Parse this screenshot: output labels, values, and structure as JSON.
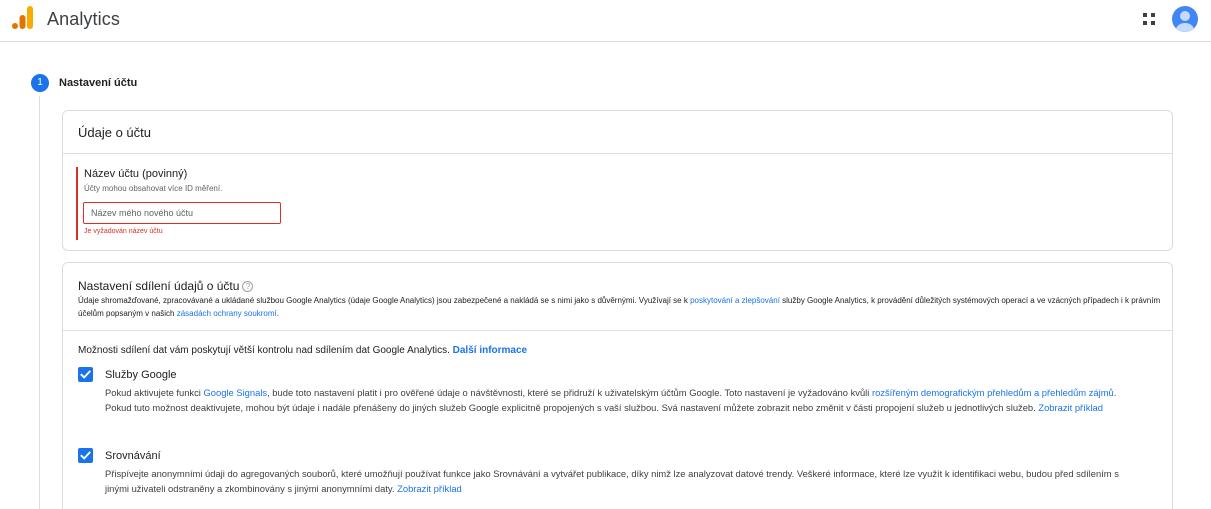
{
  "header": {
    "app_title": "Analytics",
    "icons": {
      "logo": "analytics-logo-icon",
      "apps": "apps-grid-icon",
      "avatar": "account-avatar"
    }
  },
  "stepper": {
    "step_number": "1",
    "step_title": "Nastavení účtu"
  },
  "account_card": {
    "title": "Údaje o účtu",
    "field": {
      "label": "Název účtu (povinný)",
      "hint": "Účty mohou obsahovat více ID měření.",
      "value": "",
      "placeholder": "Název mého nového účtu",
      "error": "Je vyžadován název účtu"
    }
  },
  "sharing_card": {
    "title": "Nastavení sdílení údajů o účtu",
    "help_icon": "?",
    "desc_1": "Údaje shromažďované, zpracovávané a ukládané službou Google Analytics (údaje Google Analytics) jsou zabezpečené a nakládá se s nimi jako s důvěrnými. Využívají se k ",
    "desc_link_1": "poskytování a zlepšování",
    "desc_2": " služby Google Analytics, k provádění důležitých systémových operací a ve vzácných případech i k právním účelům popsaným v našich ",
    "desc_link_2": "zásadách ochrany soukromí",
    "desc_3": ".",
    "options_intro": "Možnosti sdílení dat vám poskytují větší kontrolu nad sdílením dat Google Analytics. ",
    "options_intro_link": "Další informace",
    "options": [
      {
        "title": "Služby Google",
        "checked": true,
        "text_1": "Pokud aktivujete funkci ",
        "link_1": "Google Signals",
        "text_2": ", bude toto nastavení platit i pro ověřené údaje o návštěvnosti, které se přidruží k uživatelským účtům Google. Toto nastavení je vyžadováno kvůli ",
        "link_2": "rozšířeným demografickým přehledům a přehledům zájmů",
        "text_3": ". Pokud tuto možnost deaktivujete, mohou být údaje i nadále přenášeny do jiných služeb Google explicitně propojených s vaší službou. Svá nastavení můžete zobrazit nebo změnit v části propojení služeb u jednotlivých služeb. ",
        "link_3": "Zobrazit příklad"
      },
      {
        "title": "Srovnávání",
        "checked": true,
        "text_1": "Přispívejte anonymními údaji do agregovaných souborů, které umožňují používat funkce jako Srovnávání a vytvářet publikace, díky nimž lze analyzovat datové trendy. Veškeré informace, které lze využít k identifikaci webu, budou před sdílením s jinými uživateli odstraněny a zkombinovány s jinými anonymními daty. ",
        "link_1": "Zobrazit příklad"
      }
    ]
  },
  "colors": {
    "primary": "#1a73e8",
    "error": "#d93025",
    "border": "#dadce0",
    "logo_orange": "#f9ab00",
    "logo_dark_orange": "#e37400"
  }
}
